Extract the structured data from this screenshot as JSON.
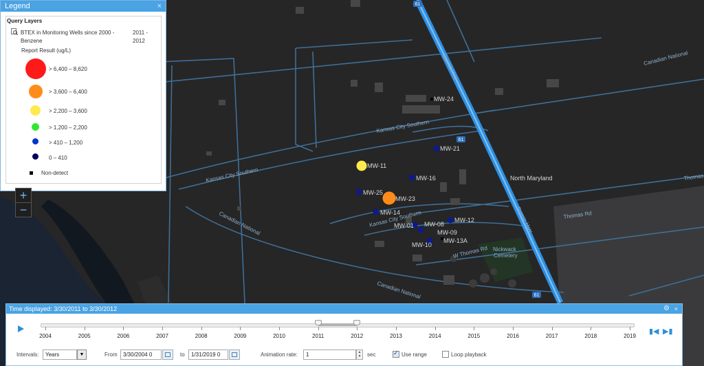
{
  "legend": {
    "title": "Legend",
    "close": "×",
    "section": "Query Layers",
    "layer_name": "BTEX in Monitoring Wells since 2000 - Benzene",
    "layer_years": "2011 - 2012",
    "field": "Report Result (ug/L)",
    "classes": [
      {
        "label": "> 6,400 – 8,620",
        "color": "#ff1a1a"
      },
      {
        "label": "> 3,600 – 6,400",
        "color": "#ff8c1a"
      },
      {
        "label": "> 2,200 – 3,600",
        "color": "#ffe94d"
      },
      {
        "label": "> 1,200 – 2,200",
        "color": "#33e633"
      },
      {
        "label": "> 410 – 1,200",
        "color": "#0033cc"
      },
      {
        "label": "0 – 410",
        "color": "#00005e"
      },
      {
        "label": "Non-detect",
        "color": "#000000"
      }
    ]
  },
  "zoom": {
    "in": "+",
    "out": "−"
  },
  "map": {
    "wells": [
      {
        "label": "MW-24"
      },
      {
        "label": "MW-21"
      },
      {
        "label": "MW-11"
      },
      {
        "label": "MW-16"
      },
      {
        "label": "MW-25"
      },
      {
        "label": "MW-23"
      },
      {
        "label": "MW-14"
      },
      {
        "label": "MW-12"
      },
      {
        "label": "MW-01"
      },
      {
        "label": "MW-08"
      },
      {
        "label": "MW-09"
      },
      {
        "label": "MW-13A"
      },
      {
        "label": "MW-10"
      }
    ],
    "streets": {
      "kcs1": "Kansas City Southern",
      "kcs2": "Kansas City Southern",
      "kcs3": "Kansas City Southern",
      "cn1": "Canadian National",
      "cn2": "Canadian National",
      "cn3": "Canadian National",
      "scenic1": "Scenic Hwy",
      "scenic2": "Scenic Hwy",
      "north_maryland": "North Maryland",
      "thomas1": "Thomas Rd",
      "thomas2": "Thomas Rd",
      "w_thomas": "W Thomas Rd",
      "cemetery1": "Nickwack",
      "cemetery2": "Cemetery",
      "shield": "61"
    }
  },
  "time_slider": {
    "title": "Time displayed: 3/30/2011 to 3/30/2012",
    "gear": "⚙",
    "close": "×",
    "years": [
      "2004",
      "2005",
      "2006",
      "2007",
      "2008",
      "2009",
      "2010",
      "2011",
      "2012",
      "2013",
      "2014",
      "2015",
      "2016",
      "2017",
      "2018",
      "2019"
    ],
    "range_start_year": 2011,
    "range_end_year": 2012,
    "intervals_label": "Intervals:",
    "intervals_value": "Years",
    "from_label": "From",
    "from_value": "3/30/2004 0",
    "to_label": "to",
    "to_value": "1/31/2019 0",
    "rate_label": "Animation rate:",
    "rate_value": "1",
    "sec_label": "sec",
    "use_range_label": "Use range",
    "use_range_checked": true,
    "loop_label": "Loop playback",
    "loop_checked": false
  }
}
